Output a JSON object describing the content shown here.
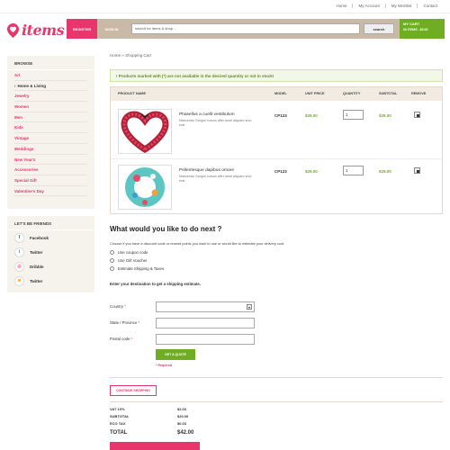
{
  "topnav": [
    "Home",
    "My Account",
    "My Wishlist",
    "Contact"
  ],
  "brand": {
    "name": "items",
    "accent": "#e8356b",
    "green": "#6fae23"
  },
  "header": {
    "register_label": "REGISTER",
    "signin_label": "SIGN IN",
    "search_placeholder": "search for items & shop ...",
    "search_button": "search",
    "cart_title": "MY CART",
    "cart_summary": "00 ITEMS - $0.00"
  },
  "sidebar": {
    "browse_heading": "BROWSE",
    "categories": [
      "Art",
      "Home & Living",
      "Jewelry",
      "Women",
      "Men",
      "Kids",
      "Vintage",
      "Weddings",
      "New Year's",
      "Accessories",
      "Special Gift",
      "Valentine's Day"
    ],
    "active_category": "Home & Living",
    "friends_heading": "LET'S BE FRIENDS",
    "friends": [
      {
        "label": "Facebook",
        "icon": "facebook-icon",
        "glyph": "f",
        "color": "#3b5998"
      },
      {
        "label": "Twitter",
        "icon": "twitter-icon",
        "glyph": "t",
        "color": "#29a9e1"
      },
      {
        "label": "Dribble",
        "icon": "dribbble-icon",
        "glyph": "◎",
        "color": "#ea4c89"
      },
      {
        "label": "Twitter",
        "icon": "rss-icon",
        "glyph": "≋",
        "color": "#f7941e"
      }
    ]
  },
  "breadcrumb": {
    "home": "Home",
    "sep": "»",
    "current": "Shopping Cart"
  },
  "warning": "! Products marked with (*) are not available in the desired quantity or not in stock!",
  "cart": {
    "headers": {
      "name": "PRODUCT NAME",
      "model": "MODEL",
      "price": "UNIT PRICE",
      "qty": "QUANTITY",
      "subtotal": "SUBTOTAL",
      "remove": "REMOVE"
    },
    "items": [
      {
        "name": "Phasellus a cuelit vestibulum",
        "desc": "Maecenas Congue cursus after amet aliquam arcu erat",
        "model": "CP123",
        "price": "$29.00",
        "qty": "1",
        "subtotal": "$29.00",
        "image": "heart-wreath"
      },
      {
        "name": "Pellentesque dapibus ornare",
        "desc": "Maecenas Congue cursus after amet aliquam arcu erat",
        "model": "CP123",
        "price": "$29.00",
        "qty": "1",
        "subtotal": "$29.00",
        "image": "floral-wreath"
      }
    ]
  },
  "next": {
    "title": "What would you like to do next ?",
    "desc": "Choose if you have a discount code or reward points you want to use or would like to estimate your delivery cost.",
    "options": [
      "Use coupon code",
      "Use Gift Voucher",
      "Estimate Shipping & Taxes"
    ],
    "destination": "Enter your destination to get a shipping estimate."
  },
  "form": {
    "country_label": "Country",
    "region_label": "State / Province",
    "postcode_label": "Postal code",
    "required_mark": "*",
    "quote_button": "GET A QUOTE",
    "required_note": "* Required"
  },
  "continue_label": "CONTINUE SHOPPING",
  "totals": [
    {
      "label": "VAT 10%",
      "value": "$2.03"
    },
    {
      "label": "SUBTOTAL",
      "value": "$20.00"
    },
    {
      "label": "ECO TAX",
      "value": "$0.03"
    }
  ],
  "total": {
    "label": "TOTAL",
    "value": "$42.00"
  }
}
